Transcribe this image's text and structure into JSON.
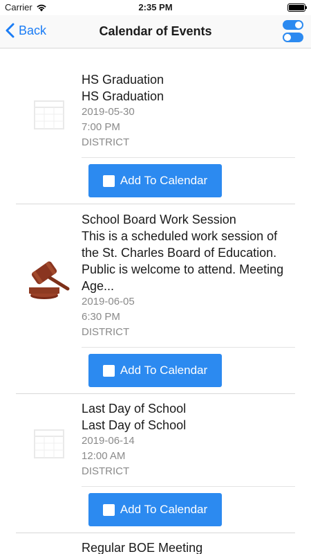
{
  "status_bar": {
    "carrier": "Carrier",
    "time": "2:35 PM"
  },
  "nav": {
    "back_label": "Back",
    "title": "Calendar of Events"
  },
  "events": [
    {
      "title": "HS Graduation",
      "desc": "HS Graduation",
      "date": "2019-05-30",
      "time": "7:00 PM",
      "location": "DISTRICT",
      "icon": "calendar-icon",
      "button_label": "Add To Calendar"
    },
    {
      "title": "School Board Work Session",
      "desc": "This is a scheduled work session of the St. Charles Board of Education.  Public is welcome to attend.  Meeting Age...",
      "date": "2019-06-05",
      "time": "6:30 PM",
      "location": "DISTRICT",
      "icon": "gavel-icon",
      "button_label": "Add To Calendar"
    },
    {
      "title": "Last Day of School",
      "desc": "Last Day of School",
      "date": "2019-06-14",
      "time": "12:00 AM",
      "location": "DISTRICT",
      "icon": "calendar-icon",
      "button_label": "Add To Calendar"
    },
    {
      "title": "Regular BOE Meeting"
    }
  ],
  "colors": {
    "accent": "#1a7cf5",
    "button": "#2c8af0",
    "meta_text": "#8a8a8a"
  }
}
